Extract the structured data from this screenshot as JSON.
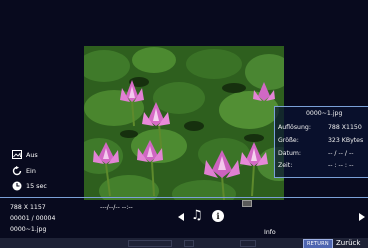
{
  "file_info": {
    "filename": "0000~1.jpg",
    "rows": [
      {
        "label": "Auflösung:",
        "value": "788 X1150"
      },
      {
        "label": "Größe:",
        "value": "323 KBytes"
      },
      {
        "label": "Datum:",
        "value": "-- / -- / --"
      },
      {
        "label": "Zeit:",
        "value": "-- : -- : --"
      }
    ]
  },
  "slideshow_options": [
    {
      "icon": "picture-icon",
      "label": "Aus"
    },
    {
      "icon": "repeat-icon",
      "label": "Ein"
    },
    {
      "icon": "clock-icon",
      "label": "15 sec"
    }
  ],
  "status": {
    "resolution": "788 X 1157",
    "index": "00001 / 00004",
    "filename": "0000~1.jpg",
    "datetime": "---/--/-- --:--"
  },
  "controls": {
    "info_label": "Info",
    "return_key": "RETURN",
    "return_label": "Zurück"
  },
  "icons": {
    "music": "music-note-icon",
    "info": "info-icon",
    "prev": "arrow-left-icon",
    "next": "arrow-right-icon"
  },
  "colors": {
    "background": "#080a1e",
    "accent_line": "#7aa0d8",
    "return_button": "#4f66b0"
  }
}
